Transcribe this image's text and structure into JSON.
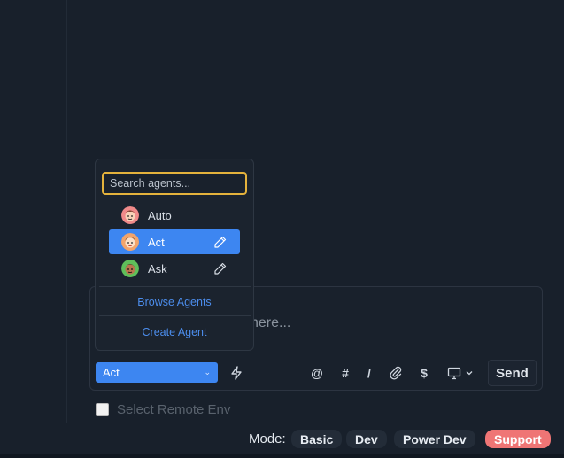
{
  "chat": {
    "placeholder": "here...",
    "agent_selected": "Act",
    "send_label": "Send",
    "remote_env_label": "Select Remote Env"
  },
  "toolbar": {
    "at": "@",
    "hash": "#",
    "slash": "/",
    "dollar": "$"
  },
  "dropdown": {
    "search_placeholder": "Search agents...",
    "agents": [
      {
        "label": "Auto",
        "active": false,
        "editable": false
      },
      {
        "label": "Act",
        "active": true,
        "editable": true
      },
      {
        "label": "Ask",
        "active": false,
        "editable": true
      }
    ],
    "browse_label": "Browse Agents",
    "create_label": "Create Agent"
  },
  "footer": {
    "mode_label": "Mode:",
    "modes": [
      "Basic",
      "Dev",
      "Power Dev"
    ],
    "support_label": "Support"
  },
  "colors": {
    "accent": "#3d86f1",
    "focus": "#e4b23c",
    "support": "#ef7575",
    "link": "#4c8dec"
  }
}
